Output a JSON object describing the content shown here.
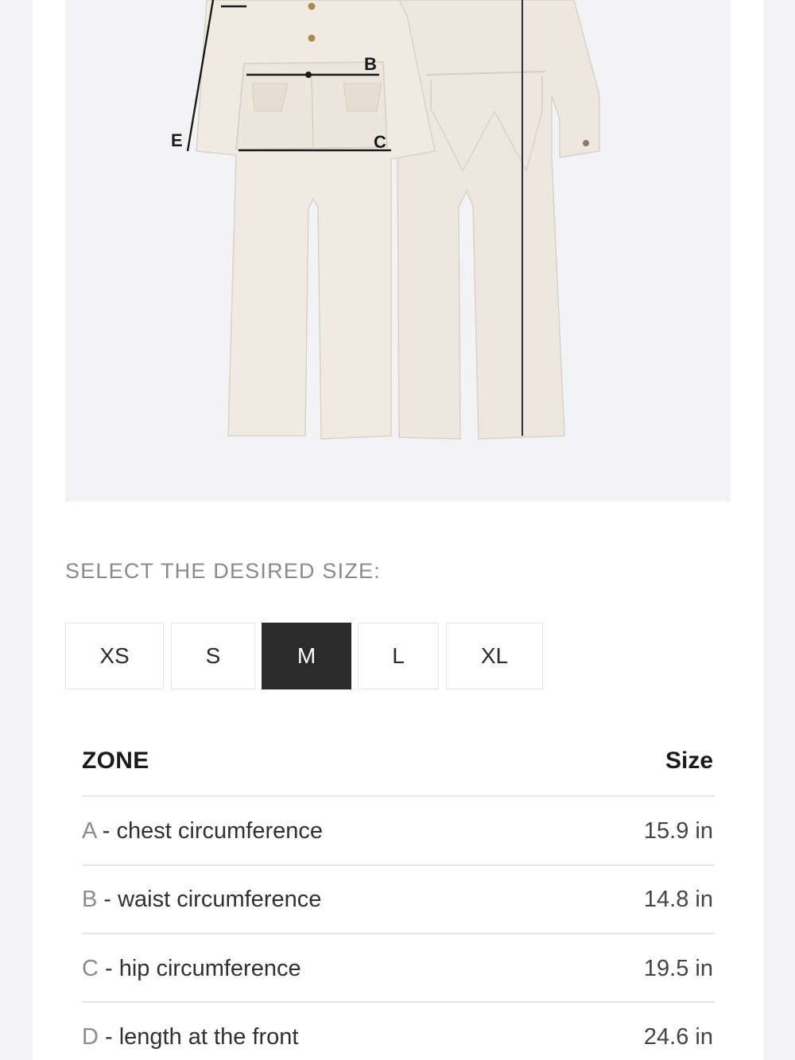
{
  "measure_labels": {
    "e": "E",
    "b": "B",
    "c": "C"
  },
  "size_selector": {
    "prompt": "SELECT THE DESIRED SIZE:",
    "sizes": [
      "XS",
      "S",
      "M",
      "L",
      "XL"
    ],
    "selected": "M"
  },
  "table": {
    "headers": {
      "zone": "ZONE",
      "size": "Size"
    },
    "rows": [
      {
        "letter": "A",
        "label": " - chest circumference",
        "value": "15.9 in"
      },
      {
        "letter": "B",
        "label": " - waist circumference",
        "value": "14.8 in"
      },
      {
        "letter": "C",
        "label": " - hip circumference",
        "value": "19.5 in"
      },
      {
        "letter": "D",
        "label": " - length at the front",
        "value": "24.6 in"
      }
    ]
  },
  "colors": {
    "garment": "#ece8df",
    "selected_bg": "#2b2b2b",
    "image_bg": "#f3f3f6"
  }
}
